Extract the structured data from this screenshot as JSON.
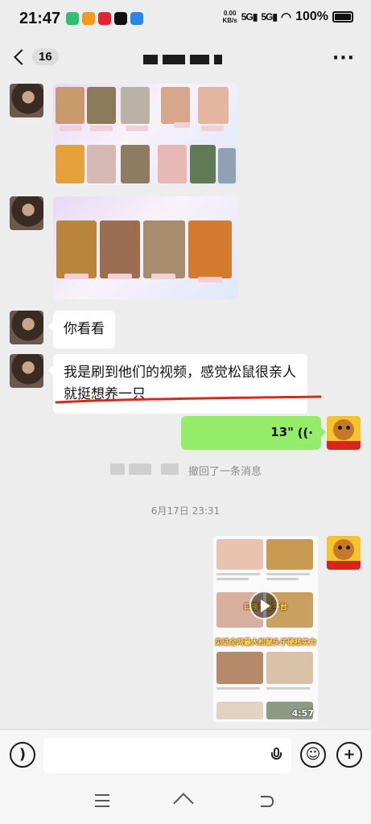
{
  "status_bar": {
    "time": "21:47",
    "net_speed_value": "0.00",
    "net_speed_unit": "KB/s",
    "sim1": "5G",
    "sim2": "5G",
    "battery": "100%"
  },
  "header": {
    "unread_count": "16",
    "more_label": "···"
  },
  "messages": {
    "text_1": "你看看",
    "text_2": "我是刷到他们的视频，感觉松鼠很亲人就挺想养一只",
    "voice_duration": "13\"",
    "recall_notice": "撤回了一条消息",
    "timestamp": "6月17日 23:31",
    "video_banner_1": "口播专业平台",
    "video_banner_2": "见证全网最大松鼠头子硬核实力",
    "video_duration": "4:57"
  },
  "icons": {
    "voice_wave": "((·",
    "voice_toggle": "voice-toggle-icon",
    "emoji": "emoji-icon",
    "plus": "plus-icon",
    "mic": "mic-icon"
  },
  "colors": {
    "sent_bubble": "#95ec69",
    "received_bubble": "#ffffff",
    "annotation_red": "#d42b1f",
    "background": "#ededed"
  }
}
